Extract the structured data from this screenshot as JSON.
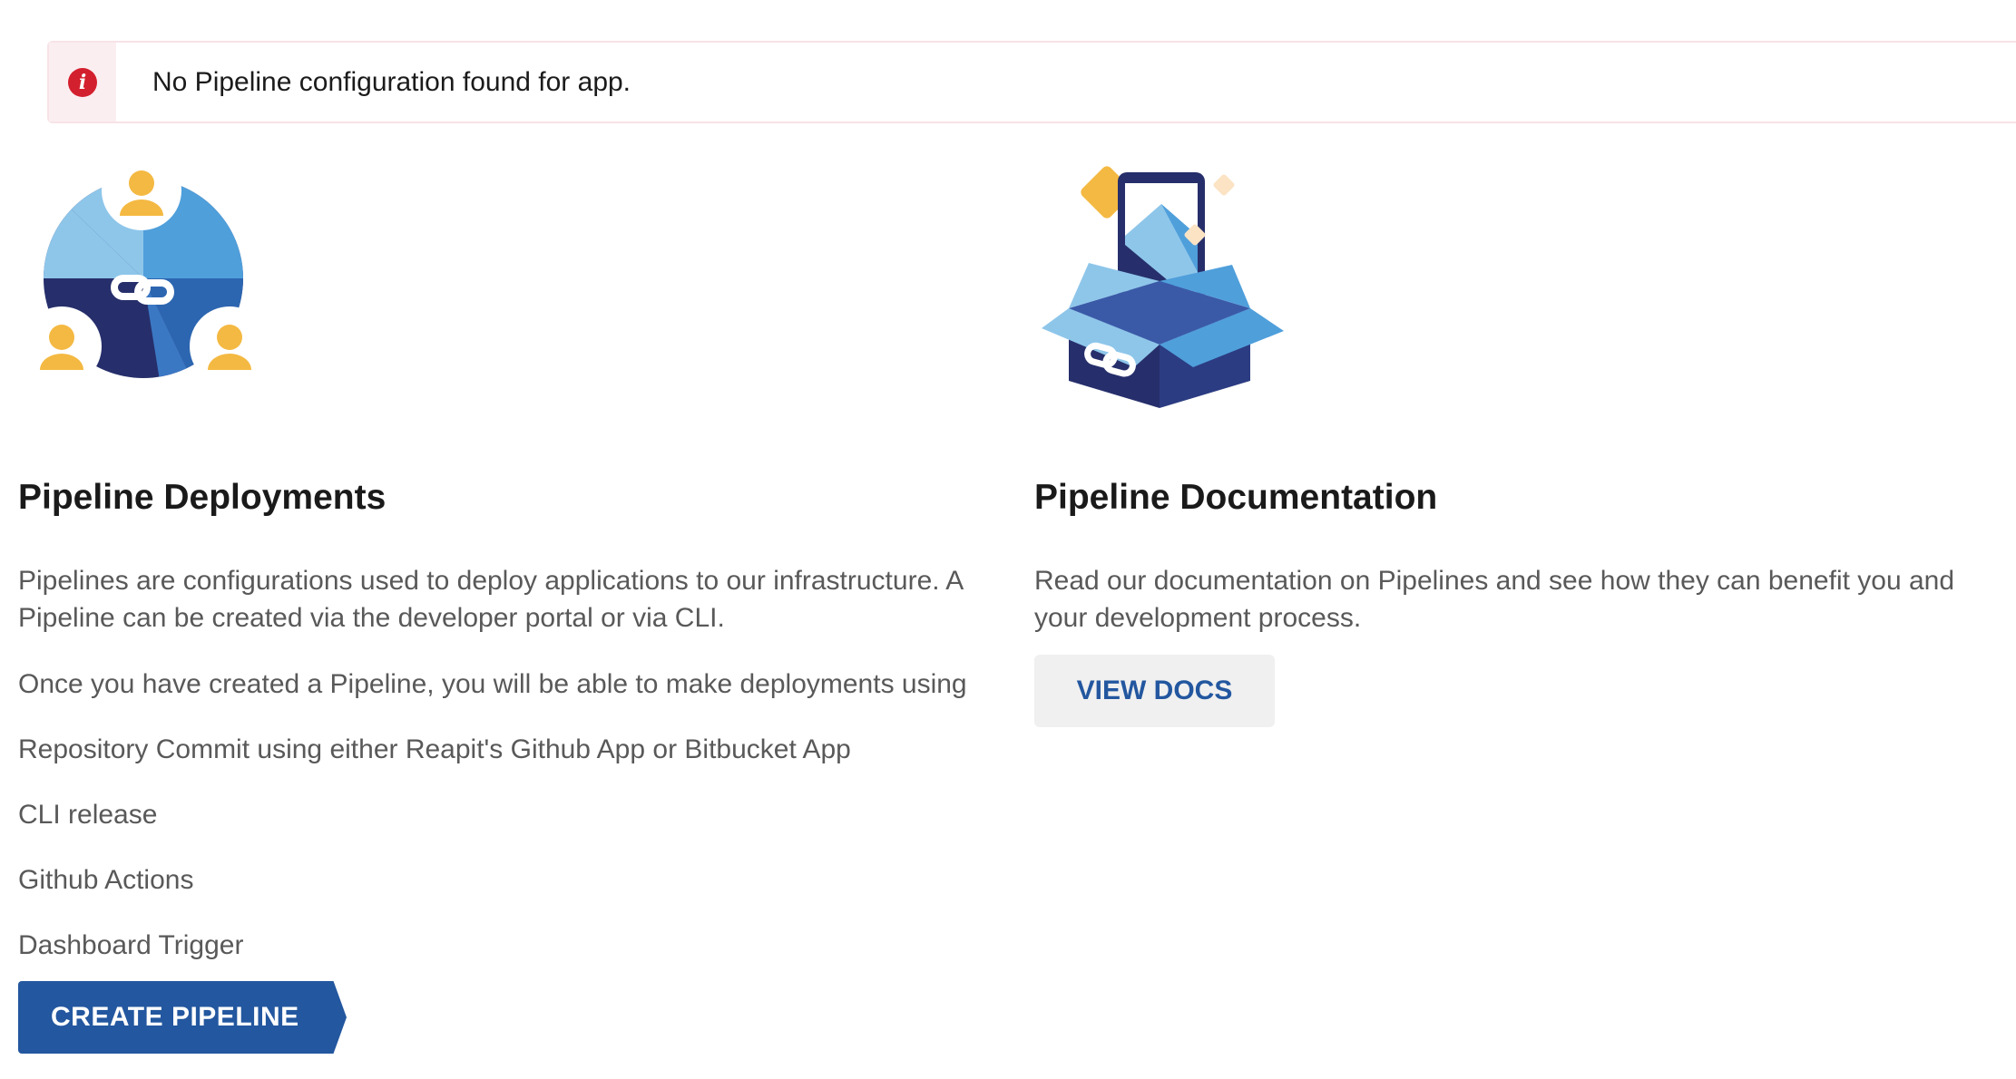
{
  "alert": {
    "message": "No Pipeline configuration found for app.",
    "icon": "info-icon",
    "color": "#d3202e"
  },
  "deployments": {
    "heading": "Pipeline Deployments",
    "intro": "Pipelines are configurations used to deploy applications to our infrastructure. A Pipeline can be created via the developer portal or via CLI.",
    "lead": "Once you have created a Pipeline, you will be able to make deployments using",
    "methods": [
      "Repository Commit using either Reapit's Github App or Bitbucket App",
      "CLI release",
      "Github Actions",
      "Dashboard Trigger"
    ],
    "button_label": "CREATE PIPELINE"
  },
  "documentation": {
    "heading": "Pipeline Documentation",
    "intro": "Read our documentation on Pipelines and see how they can benefit you and your development process.",
    "button_label": "VIEW DOCS"
  },
  "colors": {
    "primary": "#23579f",
    "navy": "#262f6b",
    "light_blue": "#8ec6ea",
    "mid_blue": "#4f9fdb",
    "yellow": "#f4b942"
  }
}
